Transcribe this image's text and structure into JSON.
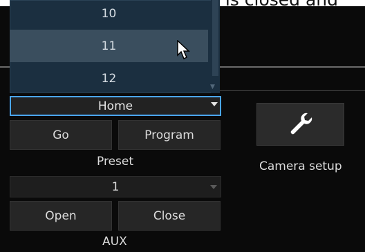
{
  "instruction": "The pull-down menu is closed and",
  "dropdown": {
    "items": [
      "10",
      "11",
      "12"
    ],
    "hover_index": 1
  },
  "preset": {
    "selected": "Home",
    "go_label": "Go",
    "program_label": "Program",
    "label": "Preset"
  },
  "aux": {
    "selected": "1",
    "open_label": "Open",
    "close_label": "Close",
    "label": "AUX"
  },
  "camera_setup": {
    "label": "Camera setup",
    "icon": "wrench-icon"
  },
  "colors": {
    "focus_border": "#4aa6ff",
    "dropdown_bg": "#1b2f40",
    "hover_bg": "#3a4e5e"
  }
}
